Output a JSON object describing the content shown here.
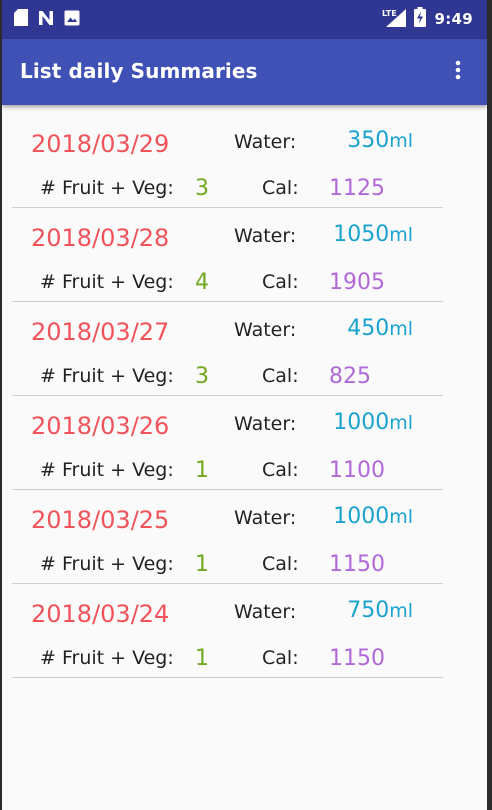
{
  "status_bar": {
    "time": "9:49",
    "icons_left": [
      "sd-card-icon",
      "n-notification-icon",
      "image-notification-icon"
    ],
    "icons_right": [
      "lte-signal-icon",
      "battery-charging-icon"
    ]
  },
  "app_bar": {
    "title": "List daily Summaries",
    "overflow_icon": "more-vertical-icon"
  },
  "labels": {
    "water": "Water:",
    "fruit_veg": "# Fruit + Veg:",
    "cal": "Cal:",
    "water_unit": "ml"
  },
  "summaries": [
    {
      "date": "2018/03/29",
      "water": "350",
      "fruit_veg": "3",
      "cal": "1125"
    },
    {
      "date": "2018/03/28",
      "water": "1050",
      "fruit_veg": "4",
      "cal": "1905"
    },
    {
      "date": "2018/03/27",
      "water": "450",
      "fruit_veg": "3",
      "cal": "825"
    },
    {
      "date": "2018/03/26",
      "water": "1000",
      "fruit_veg": "1",
      "cal": "1100"
    },
    {
      "date": "2018/03/25",
      "water": "1000",
      "fruit_veg": "1",
      "cal": "1150"
    },
    {
      "date": "2018/03/24",
      "water": "750",
      "fruit_veg": "1",
      "cal": "1150"
    }
  ],
  "colors": {
    "status_bar": "#2f3793",
    "app_bar": "#3f51b5",
    "date": "#f0545a",
    "water": "#1aa3cf",
    "fruit_veg": "#72a820",
    "cal": "#b069d6"
  }
}
